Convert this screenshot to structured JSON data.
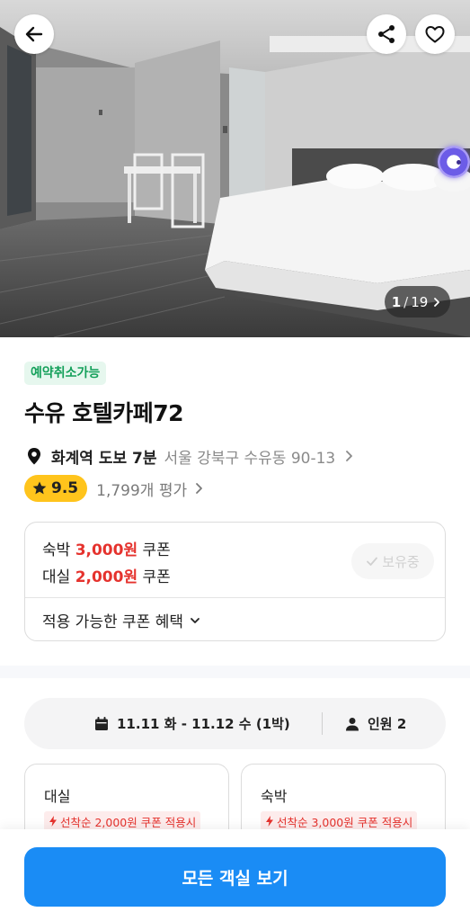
{
  "gallery": {
    "current": "1",
    "separator": "/",
    "total": "19"
  },
  "badges": {
    "free_cancel": "예약취소가능"
  },
  "hotel": {
    "name": "수유 호텔카페72",
    "station": "화계역 도보 7분",
    "address": "서울 강북구 수유동 90-13",
    "rating": "9.5",
    "review_count": "1,799개 평가"
  },
  "coupons": {
    "lines": [
      {
        "type": "숙박",
        "amount": "3,000원",
        "suffix": "쿠폰"
      },
      {
        "type": "대실",
        "amount": "2,000원",
        "suffix": "쿠폰"
      }
    ],
    "owned_label": "보유중",
    "benefit_label": "적용 가능한 쿠폰 혜택"
  },
  "booking": {
    "dates": "11.11 화 - 11.12 수 (1박)",
    "guests": "인원 2"
  },
  "rooms": [
    {
      "type": "대실",
      "tag": "선착순 2,000원 쿠폰 적용시"
    },
    {
      "type": "숙박",
      "tag": "선착순 3,000원 쿠폰 적용시"
    }
  ],
  "cta": {
    "view_all": "모든 객실 보기"
  },
  "colors": {
    "accent_blue": "#1a8cf5",
    "discount_red": "#e5322d",
    "rating_yellow": "#ffc41c",
    "cancel_green": "#14a05a"
  },
  "icons": {
    "back": "arrow-left-icon",
    "share": "share-icon",
    "favorite": "heart-icon",
    "location": "map-pin-icon",
    "rating": "star-icon",
    "calendar": "calendar-icon",
    "person": "person-icon",
    "lightning": "lightning-icon"
  }
}
